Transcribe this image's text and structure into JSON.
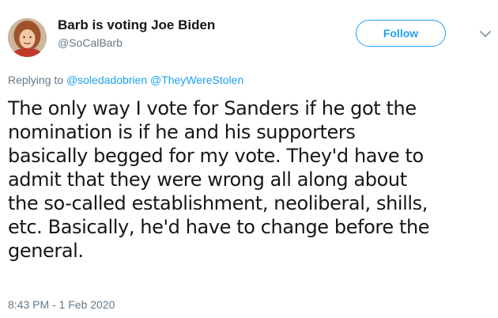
{
  "author": {
    "display_name": "Barb is voting Joe Biden",
    "handle": "@SoCalBarb"
  },
  "follow_label": "Follow",
  "reply": {
    "prefix": "Replying to",
    "mentions": [
      "@soledadobrien",
      "@TheyWereStolen"
    ]
  },
  "tweet_lines": [
    "The only way I vote for Sanders if he got the",
    "nomination is if he and his supporters",
    "basically begged for my vote. They'd have to",
    "admit that they were wrong all along about",
    "the so-called establishment, neoliberal, shills,",
    "etc. Basically, he'd have to change before the",
    "general."
  ],
  "timestamp": "8:43 PM - 1 Feb 2020",
  "colors": {
    "accent": "#1da1f2",
    "secondary_text": "#657786",
    "primary_text": "#14171a"
  },
  "icons": {
    "menu": "chevron-down-icon"
  }
}
